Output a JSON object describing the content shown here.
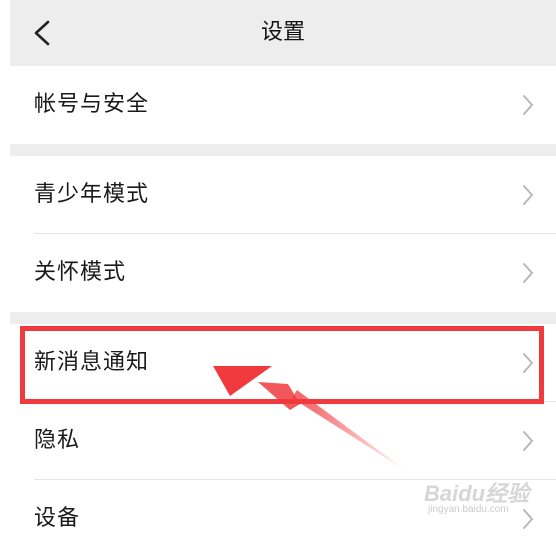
{
  "header": {
    "title": "设置",
    "back_icon": "chevron-left-icon"
  },
  "groups": [
    {
      "items": [
        {
          "label": "帐号与安全",
          "icon": "chevron-right-icon"
        }
      ]
    },
    {
      "items": [
        {
          "label": "青少年模式",
          "icon": "chevron-right-icon"
        },
        {
          "label": "关怀模式",
          "icon": "chevron-right-icon"
        }
      ]
    },
    {
      "items": [
        {
          "label": "新消息通知",
          "icon": "chevron-right-icon"
        },
        {
          "label": "隐私",
          "icon": "chevron-right-icon"
        },
        {
          "label": "设备",
          "icon": "chevron-right-icon"
        }
      ]
    }
  ],
  "annotation": {
    "highlight_color": "#f03a3e",
    "highlighted_item": "新消息通知"
  },
  "watermark": {
    "logo_text": "Baidu经验",
    "sub_text": "jingyan.baidu.com"
  }
}
